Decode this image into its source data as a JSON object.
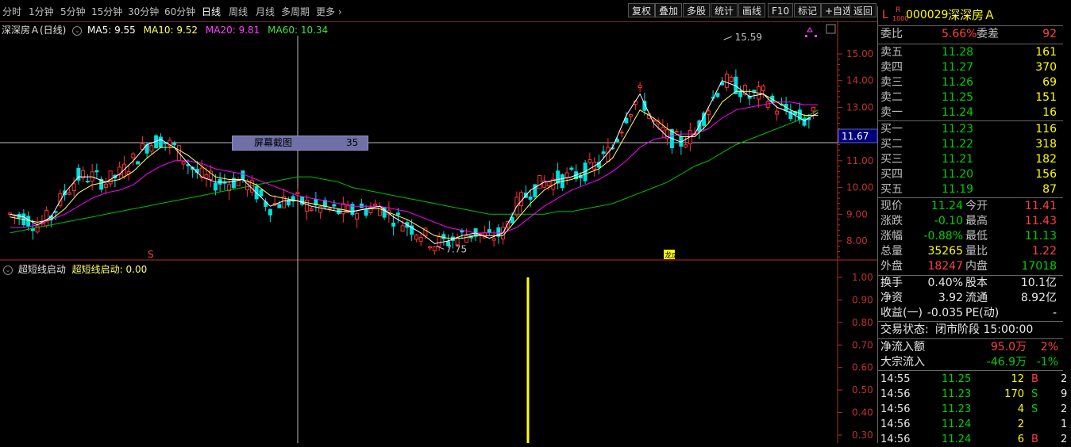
{
  "toolbar": {
    "periods": [
      "分时",
      "1分钟",
      "5分钟",
      "15分钟",
      "30分钟",
      "60分钟",
      "日线",
      "周线",
      "月线",
      "多周期",
      "更多"
    ],
    "active_period": "日线",
    "buttons": [
      "复权",
      "叠加",
      "多股",
      "统计",
      "画线",
      "F10",
      "标记",
      "+自选",
      "返回"
    ]
  },
  "ma_header": {
    "stock": "深深房Ａ(日线)",
    "ma5": "MA5: 9.55",
    "ma10": "MA10: 9.52",
    "ma20": "MA20: 9.81",
    "ma60": "MA60: 10.34"
  },
  "colors": {
    "ma5": "#ffffff",
    "ma10": "#ffff66",
    "ma20": "#ff00ff",
    "ma60": "#00c000",
    "up": "#ff3232",
    "down": "#00e0e0",
    "indicator": "#ffff00"
  },
  "price_axis": {
    "ticks": [
      "15.00",
      "14.00",
      "13.00",
      "12.00",
      "11.00",
      "10.00",
      "9.00",
      "8.00"
    ],
    "current": "11.67",
    "high_label": "15.59",
    "low_label": "7.75"
  },
  "markers": {
    "s_mark": "S",
    "bang_mark": "龙虎榜"
  },
  "screenshot_tip": {
    "label": "屏幕截图",
    "value": "35"
  },
  "indicator": {
    "name": "超短线启动",
    "value_text": "超短线启动: 0.00",
    "ticks": [
      "1.00",
      "0.90",
      "0.80",
      "0.70",
      "0.60",
      "0.50",
      "0.40",
      "0.30"
    ]
  },
  "quote": {
    "code": "000029",
    "name": "深深房Ａ",
    "prefix_l": "L",
    "prefix_r": "R",
    "prefix_num": "1000",
    "webi_label": "委比",
    "webi": "5.66%",
    "wecha_label": "委差",
    "wecha": "92",
    "asks": [
      {
        "label": "卖五",
        "price": "11.28",
        "vol": "161"
      },
      {
        "label": "卖四",
        "price": "11.27",
        "vol": "370"
      },
      {
        "label": "卖三",
        "price": "11.26",
        "vol": "69"
      },
      {
        "label": "卖二",
        "price": "11.25",
        "vol": "151"
      },
      {
        "label": "卖一",
        "price": "11.24",
        "vol": "16"
      }
    ],
    "bids": [
      {
        "label": "买一",
        "price": "11.23",
        "vol": "116"
      },
      {
        "label": "买二",
        "price": "11.22",
        "vol": "318"
      },
      {
        "label": "买三",
        "price": "11.21",
        "vol": "182"
      },
      {
        "label": "买四",
        "price": "11.20",
        "vol": "156"
      },
      {
        "label": "买五",
        "price": "11.19",
        "vol": "87"
      }
    ],
    "stats": [
      {
        "l1": "现价",
        "v1": "11.24",
        "c1": "green",
        "l2": "今开",
        "v2": "11.41",
        "c2": "red"
      },
      {
        "l1": "涨跌",
        "v1": "-0.10",
        "c1": "green",
        "l2": "最高",
        "v2": "11.43",
        "c2": "red"
      },
      {
        "l1": "涨幅",
        "v1": "-0.88%",
        "c1": "green",
        "l2": "最低",
        "v2": "11.13",
        "c2": "green"
      },
      {
        "l1": "总量",
        "v1": "35265",
        "c1": "yellow",
        "l2": "量比",
        "v2": "1.22",
        "c2": "red"
      },
      {
        "l1": "外盘",
        "v1": "18247",
        "c1": "red",
        "l2": "内盘",
        "v2": "17018",
        "c2": "green"
      }
    ],
    "fund": [
      {
        "l1": "换手",
        "v1": "0.40%",
        "l2": "股本",
        "v2": "10.1亿"
      },
      {
        "l1": "净资",
        "v1": "3.92",
        "l2": "流通",
        "v2": "8.92亿"
      },
      {
        "l1": "收益(一)",
        "v1": "-0.035",
        "l2": "PE(动)",
        "v2": "-"
      }
    ],
    "status_label": "交易状态:",
    "status": "闭市阶段 15:00:00",
    "flows": [
      {
        "label": "净流入额",
        "value": "95.0万",
        "vc": "red",
        "pct": "2%",
        "pc": "red"
      },
      {
        "label": "大宗流入",
        "value": "-46.9万",
        "vc": "green",
        "pct": "-1%",
        "pc": "green"
      }
    ],
    "ticks": [
      {
        "time": "14:55",
        "price": "11.25",
        "vol": "12",
        "bs": "B",
        "n": "2"
      },
      {
        "time": "14:56",
        "price": "11.23",
        "vol": "170",
        "bs": "S",
        "n": "9"
      },
      {
        "time": "14:56",
        "price": "11.23",
        "vol": "4",
        "bs": "S",
        "n": "2"
      },
      {
        "time": "14:56",
        "price": "11.24",
        "vol": "2",
        "bs": "",
        "n": "1"
      },
      {
        "time": "14:56",
        "price": "11.24",
        "vol": "6",
        "bs": "B",
        "n": "2"
      }
    ]
  },
  "chart_data": {
    "type": "candlestick",
    "price_range": [
      7.5,
      16.0
    ],
    "indicator_range": [
      0.28,
      1.02
    ],
    "ma5": [
      9.0,
      8.9,
      8.6,
      8.9,
      9.8,
      10.4,
      10.4,
      10.2,
      10.5,
      11.0,
      11.6,
      11.8,
      11.5,
      10.9,
      10.4,
      10.2,
      10.2,
      10.3,
      9.8,
      9.3,
      9.5,
      9.5,
      9.3,
      9.2,
      9.1,
      9.1,
      9.2,
      9.3,
      8.9,
      8.6,
      8.3,
      7.9,
      8.0,
      8.2,
      8.3,
      8.1,
      8.3,
      9.3,
      9.9,
      10.2,
      10.3,
      10.4,
      10.6,
      10.9,
      11.5,
      12.7,
      13.5,
      12.4,
      11.9,
      11.7,
      12.0,
      13.0,
      14.0,
      13.8,
      13.4,
      13.5,
      13.0,
      12.8,
      12.5,
      12.8
    ],
    "ma10": [
      8.9,
      8.8,
      8.7,
      8.8,
      9.2,
      9.8,
      10.1,
      10.2,
      10.3,
      10.6,
      11.1,
      11.5,
      11.5,
      11.2,
      10.8,
      10.4,
      10.3,
      10.3,
      10.1,
      9.7,
      9.6,
      9.5,
      9.4,
      9.3,
      9.2,
      9.1,
      9.2,
      9.2,
      9.0,
      8.8,
      8.5,
      8.2,
      8.1,
      8.1,
      8.2,
      8.2,
      8.2,
      8.8,
      9.4,
      9.9,
      10.2,
      10.3,
      10.5,
      10.7,
      11.1,
      12.0,
      12.9,
      12.6,
      12.2,
      11.9,
      11.9,
      12.4,
      13.2,
      13.6,
      13.6,
      13.5,
      13.2,
      12.9,
      12.7,
      12.7
    ],
    "ma20": [
      8.5,
      8.5,
      8.6,
      8.8,
      9.0,
      9.3,
      9.6,
      9.8,
      9.9,
      10.1,
      10.5,
      10.8,
      11.0,
      11.0,
      10.9,
      10.7,
      10.6,
      10.5,
      10.3,
      10.1,
      9.9,
      9.7,
      9.6,
      9.5,
      9.4,
      9.3,
      9.3,
      9.3,
      9.2,
      9.1,
      8.9,
      8.7,
      8.5,
      8.4,
      8.3,
      8.3,
      8.3,
      8.5,
      8.9,
      9.3,
      9.6,
      9.9,
      10.1,
      10.3,
      10.6,
      11.0,
      11.5,
      11.8,
      11.9,
      12.0,
      12.0,
      12.2,
      12.6,
      12.9,
      13.0,
      13.1,
      13.2,
      13.2,
      13.1,
      13.1
    ],
    "ma60": [
      8.3,
      8.4,
      8.5,
      8.6,
      8.7,
      8.8,
      8.9,
      9.0,
      9.1,
      9.2,
      9.3,
      9.4,
      9.5,
      9.6,
      9.7,
      9.8,
      9.9,
      10.0,
      10.1,
      10.2,
      10.3,
      10.4,
      10.4,
      10.3,
      10.2,
      10.0,
      9.9,
      9.8,
      9.7,
      9.6,
      9.5,
      9.4,
      9.3,
      9.2,
      9.1,
      9.0,
      9.0,
      9.0,
      9.0,
      9.0,
      9.1,
      9.1,
      9.2,
      9.3,
      9.4,
      9.6,
      9.8,
      10.0,
      10.2,
      10.5,
      10.8,
      11.0,
      11.3,
      11.6,
      11.8,
      12.0,
      12.2,
      12.4,
      12.6,
      12.9
    ],
    "indicator_spike": {
      "index": 38,
      "value": 1.0
    }
  }
}
